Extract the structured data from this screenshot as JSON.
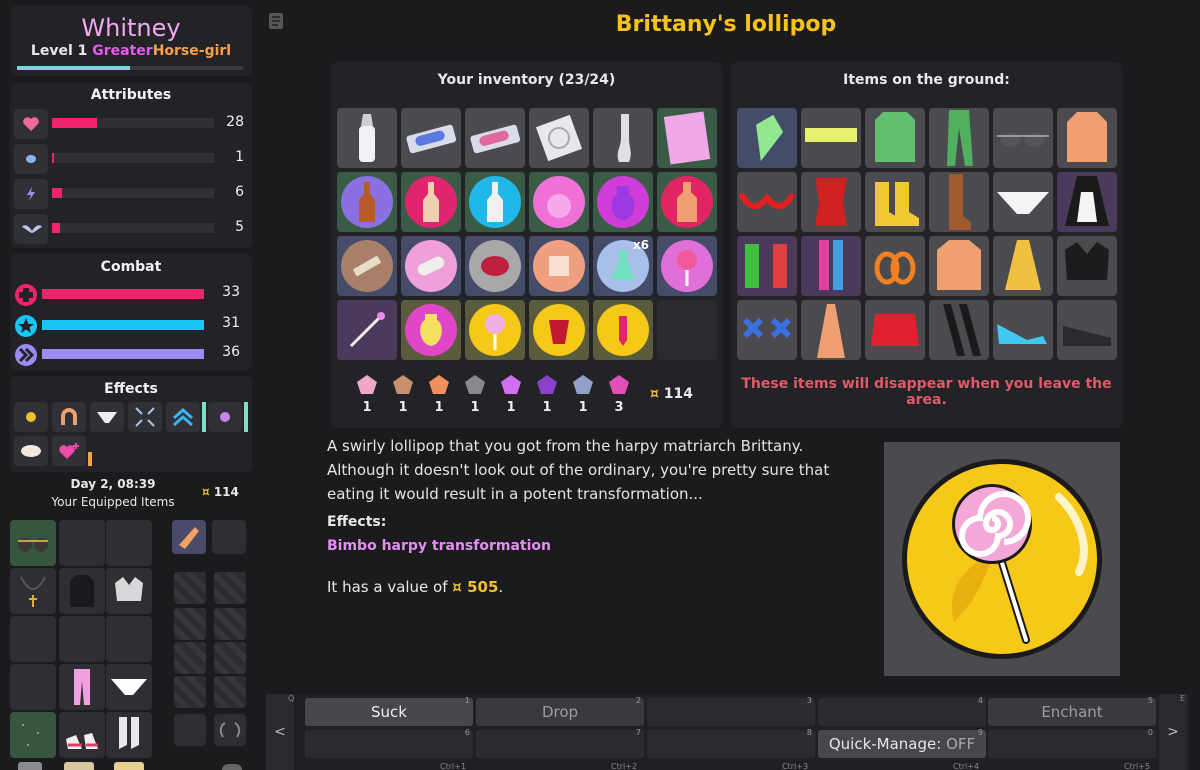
{
  "character": {
    "name": "Whitney",
    "level_word": "Level",
    "level_num": "1",
    "class_adj": "Greater",
    "class_name": "Horse-girl",
    "xp_fraction": 0.5
  },
  "attributes": {
    "title": "Attributes",
    "rows": [
      {
        "icon": "heart-icon",
        "value": "28",
        "fraction": 0.28,
        "color": "#f0246e"
      },
      {
        "icon": "brain-icon",
        "value": "1",
        "fraction": 0.01,
        "color": "#f0246e"
      },
      {
        "icon": "lightning-icon",
        "value": "6",
        "fraction": 0.06,
        "color": "#f0246e"
      },
      {
        "icon": "wings-icon",
        "value": "5",
        "fraction": 0.05,
        "color": "#f0246e"
      }
    ]
  },
  "combat": {
    "title": "Combat",
    "rows": [
      {
        "icon": "health-icon",
        "value": "33",
        "fraction": 1.0,
        "color": "#f0246e"
      },
      {
        "icon": "stamina-icon",
        "value": "31",
        "fraction": 1.0,
        "color": "#16c6f4"
      },
      {
        "icon": "arcane-icon",
        "value": "36",
        "fraction": 1.0,
        "color": "#9a8cf0"
      }
    ]
  },
  "effects": {
    "title": "Effects",
    "icons": [
      "sun-icon",
      "horseshoe-icon",
      "panties-icon",
      "arrows-icon",
      "chevrons-icon",
      "purple-sun-icon",
      "bowl-icon",
      "hearts-icon"
    ]
  },
  "time": {
    "day": "Day 2, 08:39",
    "equipped_label": "Your Equipped Items",
    "money_symbol": "¤",
    "money": "114"
  },
  "item": {
    "title": "Brittany's lollipop",
    "description": "A swirly lollipop that you got from the harpy matriarch Brittany. Although it doesn't look out of the ordinary, you're pretty sure that eating it would result in a potent transformation...",
    "effects_label": "Effects:",
    "effect": "Bimbo harpy transformation",
    "value_prefix": "It has a value of",
    "value_symbol": "¤",
    "value": "505",
    "value_suffix": "."
  },
  "inventory": {
    "title": "Your inventory (23/24)",
    "stack_count": "x6",
    "essences": [
      "1",
      "1",
      "1",
      "1",
      "1",
      "1",
      "1",
      "3"
    ],
    "money_symbol": "¤",
    "money": "114"
  },
  "ground": {
    "title": "Items on the ground:",
    "warning": "These items will disappear when you leave the area."
  },
  "actions": {
    "prev": "<",
    "next": ">",
    "q_key": "Q",
    "e_key": "E",
    "suck": "Suck",
    "drop": "Drop",
    "enchant": "Enchant",
    "quick_manage": "Quick-Manage:",
    "quick_state": "OFF",
    "keys": [
      "1",
      "2",
      "3",
      "4",
      "5",
      "6",
      "7",
      "8",
      "9",
      "0"
    ],
    "ctrl_keys": [
      "Ctrl+1",
      "Ctrl+2",
      "Ctrl+3",
      "Ctrl+4",
      "Ctrl+5"
    ]
  }
}
